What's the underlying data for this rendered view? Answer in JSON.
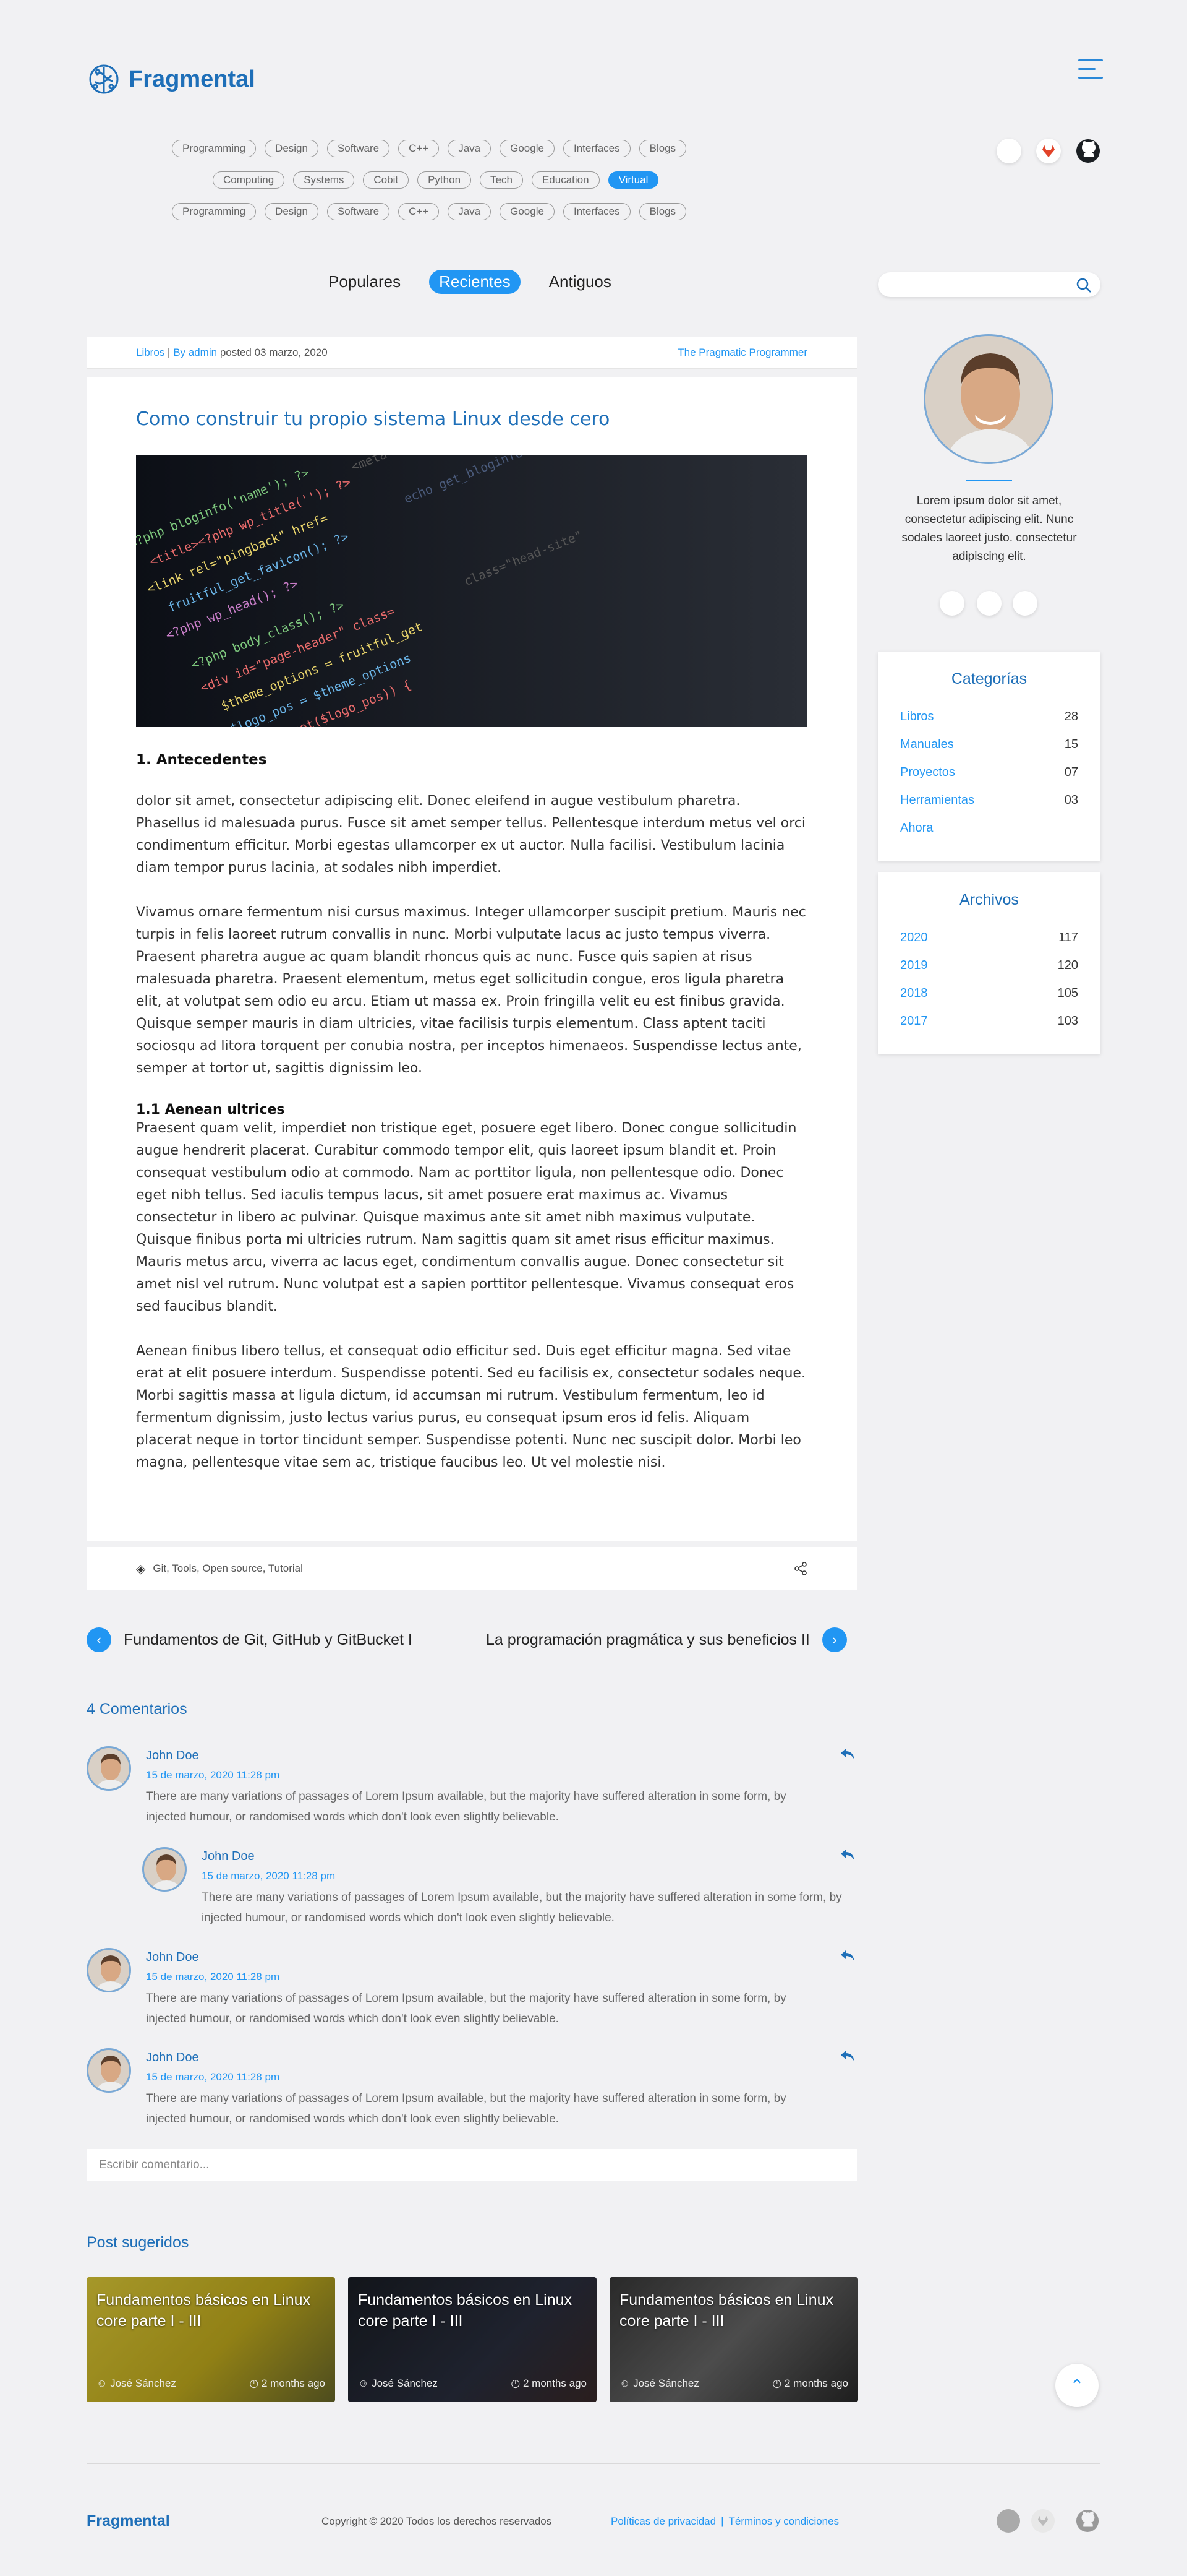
{
  "brand": {
    "name": "Fragmental"
  },
  "tag_rows": [
    [
      "Programming",
      "Design",
      "Software",
      "C++",
      "Java",
      "Google",
      "Interfaces",
      "Blogs"
    ],
    [
      "Computing",
      "Systems",
      "Cobit",
      "Python",
      "Tech",
      "Education",
      "Virtual"
    ],
    [
      "Programming",
      "Design",
      "Software",
      "C++",
      "Java",
      "Google",
      "Interfaces",
      "Blogs"
    ]
  ],
  "active_tag": "Virtual",
  "tabs": [
    "Populares",
    "Recientes",
    "Antiguos"
  ],
  "active_tab": "Recientes",
  "post": {
    "category": "Libros",
    "author_prefix": "By",
    "author": "admin",
    "posted_label": "posted",
    "date": "03 marzo, 2020",
    "source": "The Pragmatic Programmer",
    "title": "Como construir tu propio sistema Linux desde cero",
    "h2": "1. Antecedentes",
    "p1": "dolor sit amet, consectetur adipiscing elit. Donec eleifend in augue vestibulum pharetra. Phasellus id malesuada purus. Fusce sit amet semper tellus. Pellentesque interdum metus vel orci condimentum efficitur. Morbi egestas ullamcorper ex ut auctor. Nulla facilisi. Vestibulum lacinia diam tempor purus lacinia, at sodales nibh imperdiet.",
    "p2": "Vivamus ornare fermentum nisi cursus maximus. Integer ullamcorper suscipit pretium. Mauris nec turpis in felis laoreet rutrum convallis in nunc. Morbi vulputate lacus ac justo tempus viverra. Praesent pharetra augue ac quam blandit rhoncus quis ac nunc. Fusce quis sapien at risus malesuada pharetra. Praesent elementum, metus eget sollicitudin congue, eros ligula pharetra elit, at volutpat sem odio eu arcu. Etiam ut massa ex. Proin fringilla velit eu est finibus gravida. Quisque semper mauris in diam ultricies, vitae facilisis turpis elementum. Class aptent taciti sociosqu ad litora torquent per conubia nostra, per inceptos himenaeos. Suspendisse lectus ante, semper at tortor ut, sagittis dignissim leo.",
    "h3": "1.1 Aenean ultrices",
    "p3": "Praesent quam velit, imperdiet non tristique eget, posuere eget libero. Donec congue sollicitudin augue hendrerit placerat. Curabitur commodo tempor elit, quis laoreet ipsum blandit et. Proin consequat vestibulum odio at commodo. Nam ac porttitor ligula, non pellentesque odio. Donec eget nibh tellus. Sed iaculis tempus lacus, sit amet posuere erat maximus ac. Vivamus consectetur in libero ac pulvinar. Quisque maximus ante sit amet nibh maximus vulputate. Quisque finibus porta mi ultricies rutrum. Nam sagittis quam sit amet risus efficitur maximus. Mauris metus arcu, viverra ac lacus eget, condimentum convallis augue. Donec consectetur sit amet nisl vel rutrum. Nunc volutpat est a sapien porttitor pellentesque. Vivamus consequat eros sed faucibus blandit.",
    "p4": "Aenean finibus libero tellus, et consequat odio efficitur sed. Duis eget efficitur magna. Sed vitae erat at elit posuere interdum. Suspendisse potenti. Sed eu facilisis ex, consectetur sodales neque. Morbi sagittis massa at ligula dictum, id accumsan mi rutrum. Vestibulum fermentum, leo id fermentum dignissim, justo lectus varius purus, eu consequat ipsum eros id felis. Aliquam placerat neque in tortor tincidunt semper. Suspendisse potenti. Nunc nec suscipit dolor. Morbi leo magna, pellentesque vitae sem ac, tristique faucibus leo. Ut vel molestie nisi.",
    "tags": "Git, Tools, Open source, Tutorial"
  },
  "nav": {
    "prev": "Fundamentos de Git, GitHub y GitBucket I",
    "next": "La programación pragmática y sus beneficios II"
  },
  "comments": {
    "title": "4 Comentarios",
    "items": [
      {
        "name": "John Doe",
        "date": "15 de marzo, 2020  11:28 pm",
        "text": "There are many variations of passages of Lorem Ipsum available, but the majority have suffered alteration in some form, by injected humour, or randomised words which don't look even slightly believable."
      },
      {
        "name": "John Doe",
        "date": "15 de marzo, 2020  11:28 pm",
        "text": "There are many variations of passages of Lorem Ipsum available, but the majority have suffered alteration in some form, by injected humour, or randomised words which don't look even slightly believable."
      },
      {
        "name": "John Doe",
        "date": "15 de marzo, 2020  11:28 pm",
        "text": "There are many variations of passages of Lorem Ipsum available, but the majority have suffered alteration in some form, by injected humour, or randomised words which don't look even slightly believable."
      },
      {
        "name": "John Doe",
        "date": "15 de marzo, 2020  11:28 pm",
        "text": "There are many variations of passages of Lorem Ipsum available, but the majority have suffered alteration in some form, by injected humour, or randomised words which don't look even slightly believable."
      }
    ],
    "placeholder": "Escribir comentario..."
  },
  "suggested": {
    "title": "Post sugeridos",
    "items": [
      {
        "title": "Fundamentos básicos en Linux core parte I - III",
        "author": "José Sánchez",
        "time": "2 months ago"
      },
      {
        "title": "Fundamentos básicos en Linux core parte I - III",
        "author": "José Sánchez",
        "time": "2 months ago"
      },
      {
        "title": "Fundamentos básicos en Linux core parte I - III",
        "author": "José Sánchez",
        "time": "2 months ago"
      }
    ]
  },
  "sidebar": {
    "bio": "Lorem ipsum dolor sit amet, consectetur adipiscing elit. Nunc sodales laoreet justo. consectetur adipiscing elit.",
    "categories_title": "Categorías",
    "categories": [
      {
        "label": "Libros",
        "count": "28"
      },
      {
        "label": "Manuales",
        "count": "15"
      },
      {
        "label": "Proyectos",
        "count": "07"
      },
      {
        "label": "Herramientas",
        "count": "03"
      },
      {
        "label": "Ahora",
        "count": ""
      }
    ],
    "archives_title": "Archivos",
    "archives": [
      {
        "label": "2020",
        "count": "117"
      },
      {
        "label": "2019",
        "count": "120"
      },
      {
        "label": "2018",
        "count": "105"
      },
      {
        "label": "2017",
        "count": "103"
      }
    ]
  },
  "footer": {
    "brand": "Fragmental",
    "copyright": "Copyright © 2020 Todos los derechos reservados",
    "privacy": "Políticas de privacidad",
    "sep": "|",
    "terms": "Términos y condiciones"
  },
  "colors": {
    "accent": "#2196f3",
    "brand": "#1e6fb8",
    "background": "#f1f1f3"
  }
}
